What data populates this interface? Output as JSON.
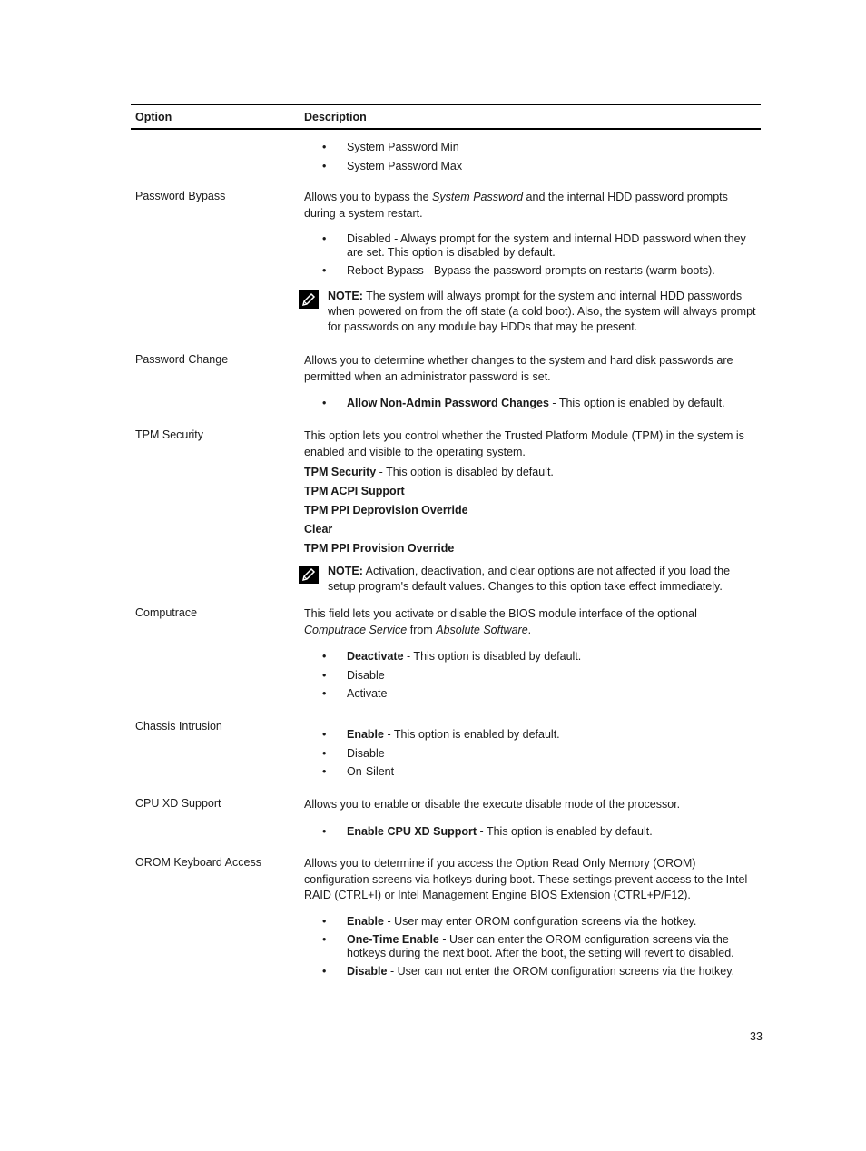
{
  "table": {
    "headers": {
      "option": "Option",
      "description": "Description"
    },
    "continuation": {
      "bullets": [
        "System Password Min",
        "System Password Max"
      ]
    },
    "password_bypass": {
      "option": "Password Bypass",
      "desc_pre": "Allows you to bypass the ",
      "desc_italic": "System Password",
      "desc_post": " and the internal HDD password prompts during a system restart.",
      "bullets": [
        "Disabled - Always prompt for the system and internal HDD password when they are set. This option is disabled by default.",
        "Reboot Bypass - Bypass the password prompts on restarts (warm boots)."
      ],
      "note_label": "NOTE:",
      "note_text": " The system will always prompt for the system and internal HDD passwords when powered on from the off state (a cold boot). Also, the system will always prompt for passwords on any module bay HDDs that may be present."
    },
    "password_change": {
      "option": "Password Change",
      "description": "Allows you to determine whether changes to the system and hard disk passwords are permitted when an administrator password is set.",
      "bullet_bold": "Allow Non-Admin Password Changes",
      "bullet_rest": " - This option is enabled by default."
    },
    "tpm_security": {
      "option": "TPM Security",
      "description": "This option lets you control whether the Trusted Platform Module (TPM) in the system is enabled and visible to the operating system.",
      "line1_bold": "TPM Security",
      "line1_rest": " - This option is disabled by default.",
      "line2": "TPM ACPI Support",
      "line3": "TPM PPI Deprovision Override",
      "line4": "Clear",
      "line5": "TPM PPI Provision Override",
      "note_label": "NOTE:",
      "note_text": " Activation, deactivation, and clear options are not affected if you load the setup program's default values. Changes to this option take effect immediately."
    },
    "computrace": {
      "option": "Computrace",
      "desc_pre": "This field lets you activate or disable the BIOS module interface of the optional ",
      "desc_italic1": "Computrace Service",
      "desc_mid": " from ",
      "desc_italic2": "Absolute Software",
      "desc_post": ".",
      "bullet1_bold": "Deactivate",
      "bullet1_rest": " - This option is disabled by default.",
      "bullet2": "Disable",
      "bullet3": "Activate"
    },
    "chassis_intrusion": {
      "option": "Chassis Intrusion",
      "bullet1_bold": "Enable",
      "bullet1_rest": " - This option is enabled by default.",
      "bullet2": "Disable",
      "bullet3": "On-Silent"
    },
    "cpu_xd": {
      "option": "CPU XD Support",
      "description": "Allows you to enable or disable the execute disable mode of the processor.",
      "bullet_bold": "Enable CPU XD Support",
      "bullet_rest": " - This option is enabled by default."
    },
    "orom": {
      "option": "OROM Keyboard Access",
      "description": "Allows you to determine if you access the Option Read Only Memory (OROM) configuration screens via hotkeys during boot. These settings prevent access to the Intel RAID (CTRL+I) or Intel Management Engine BIOS Extension (CTRL+P/F12).",
      "bullet1_bold": "Enable",
      "bullet1_rest": " - User may enter OROM configuration screens via the hotkey.",
      "bullet2_bold": "One-Time Enable",
      "bullet2_rest": " - User can enter the OROM configuration screens via the hotkeys during the next boot. After the boot, the setting will revert to disabled.",
      "bullet3_bold": "Disable",
      "bullet3_rest": " - User can not enter the OROM configuration screens via the hotkey."
    }
  },
  "bullet_char": "•",
  "page_number": "33"
}
